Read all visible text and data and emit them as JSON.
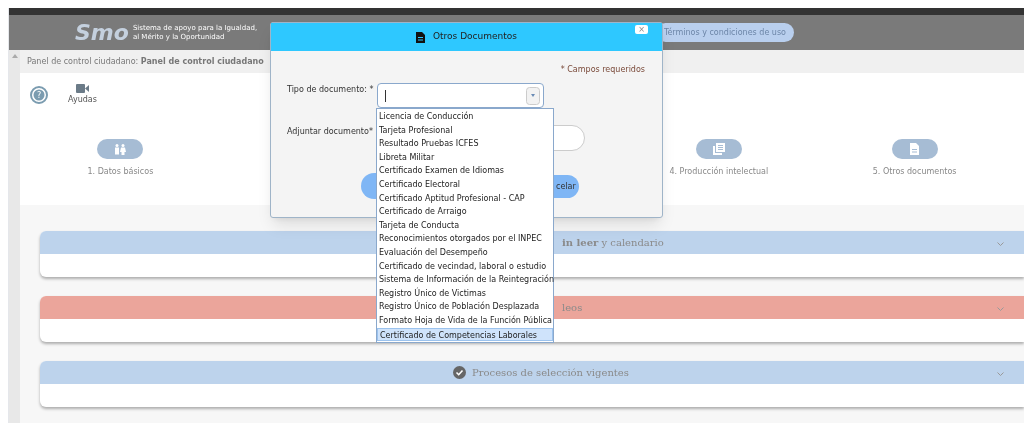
{
  "header": {
    "logo_text": "Smo",
    "logo_caption": "Sistema de apoyo para la Igualdad, al Mérito y la Oportunidad",
    "terms_button": "Términos y condiciones de uso"
  },
  "breadcrumb": "Panel de control ciudadano: **Panel de control ciudadano**",
  "help": {
    "icon": "?",
    "label": "Ayudas"
  },
  "steps": [
    {
      "label": "1. Datos básicos",
      "kind": "people"
    },
    {
      "label": "4. Producción intelectual",
      "kind": "pages"
    },
    {
      "label": "5. Otros documentos",
      "kind": "document"
    }
  ],
  "panels": [
    {
      "title": "**in leer** y calendario",
      "color": "#bdd3ec",
      "kind": "plain"
    },
    {
      "title": "leos",
      "color": "#eba59b",
      "kind": "plain"
    },
    {
      "title": "Procesos de selección vigentes",
      "color": "#bdd3ec",
      "kind": "check"
    }
  ],
  "modal": {
    "title": "Otros Documentos",
    "close": "×",
    "required_note": "* Campos requeridos",
    "type_label": "Tipo de documento: *",
    "attach_label": "Adjuntar documento*",
    "cancel_button": "celar"
  },
  "dropdown": [
    {
      "label": "Licencia de Conducción",
      "selected": false
    },
    {
      "label": "Tarjeta Profesional",
      "selected": false
    },
    {
      "label": "Resultado Pruebas ICFES",
      "selected": false
    },
    {
      "label": "Libreta Militar",
      "selected": false
    },
    {
      "label": "Certificado Examen de Idiomas",
      "selected": false
    },
    {
      "label": "Certificado Electoral",
      "selected": false
    },
    {
      "label": "Certificado Aptitud Profesional - CAP",
      "selected": false
    },
    {
      "label": "Certificado de Arraigo",
      "selected": false
    },
    {
      "label": "Tarjeta de Conducta",
      "selected": false
    },
    {
      "label": "Reconocimientos otorgados por el INPEC",
      "selected": false
    },
    {
      "label": "Evaluación del Desempeño",
      "selected": false
    },
    {
      "label": "Certificado de vecindad, laboral o estudio",
      "selected": false
    },
    {
      "label": "Sistema de Información de la Reintegración",
      "selected": false
    },
    {
      "label": "Registro Único de Victimas",
      "selected": false
    },
    {
      "label": "Registro Único de Población Desplazada",
      "selected": false
    },
    {
      "label": "Formato Hoja de Vida de la Función Pública",
      "selected": false
    },
    {
      "label": "Certificado de Competencias Laborales",
      "selected": true
    }
  ]
}
